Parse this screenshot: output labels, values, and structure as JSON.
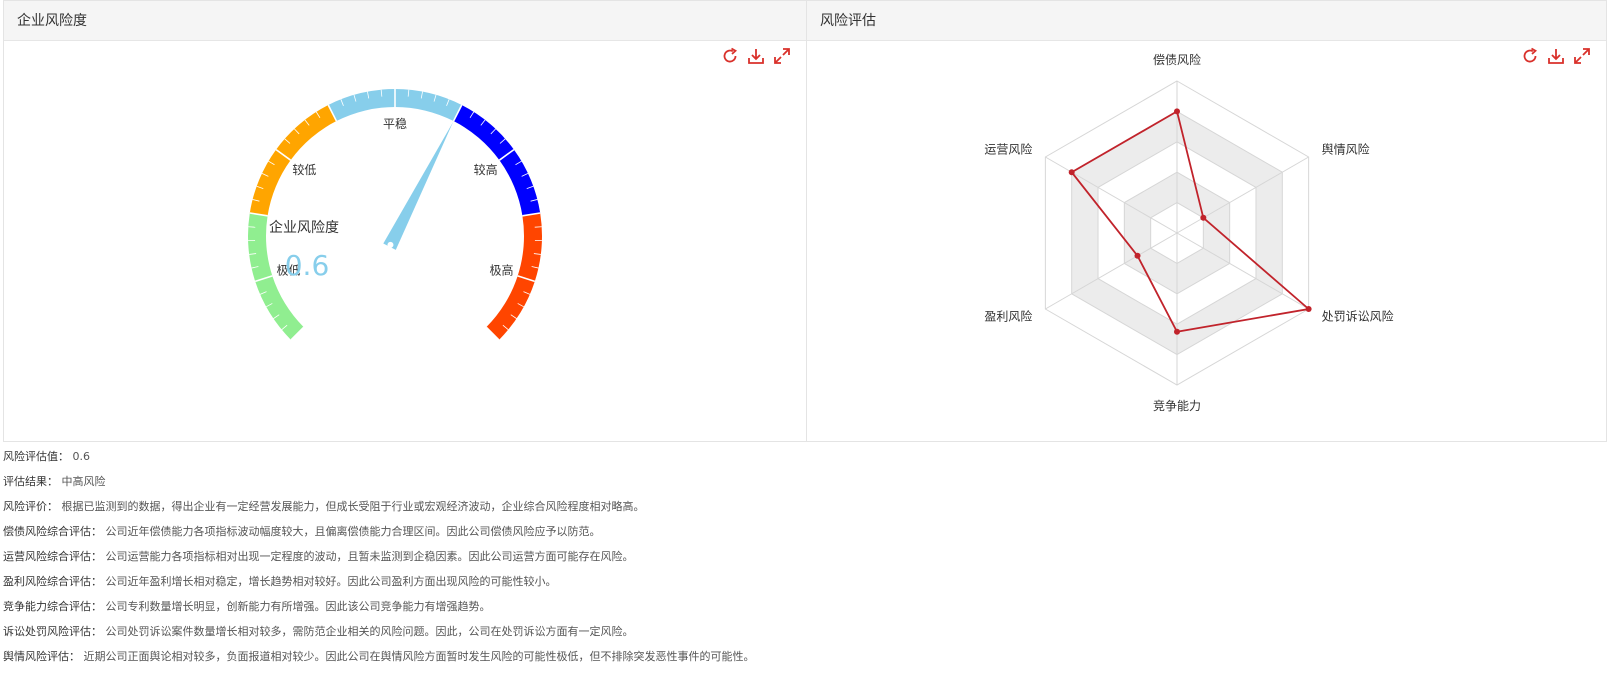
{
  "panels": {
    "left_title": "企业风险度",
    "right_title": "风险评估"
  },
  "colors": {
    "accent": "#d9312b",
    "gauge_value": "#87ceeb",
    "radar_line": "#c1232b"
  },
  "toolbox_icons": [
    "refresh-icon",
    "download-icon",
    "fullscreen-icon"
  ],
  "chart_data": [
    {
      "type": "gauge",
      "title": "企业风险度",
      "value": 0.6,
      "value_label": "0.6",
      "min": 0,
      "max": 1,
      "bands": [
        {
          "label": "极低",
          "to": 0.2,
          "color": "#90ee90"
        },
        {
          "label": "较低",
          "to": 0.4,
          "color": "#ffa500"
        },
        {
          "label": "平稳",
          "to": 0.6,
          "color": "#87ceeb"
        },
        {
          "label": "较高",
          "to": 0.8,
          "color": "#0000ff"
        },
        {
          "label": "极高",
          "to": 1.0,
          "color": "#ff4500"
        }
      ]
    },
    {
      "type": "radar",
      "indicators": [
        "偿债风险",
        "舆情风险",
        "处罚诉讼风险",
        "竞争能力",
        "盈利风险",
        "运营风险"
      ],
      "max": 1,
      "series": [
        {
          "values": [
            0.8,
            0.2,
            1.0,
            0.65,
            0.3,
            0.8
          ]
        }
      ]
    }
  ],
  "info": [
    {
      "label": "风险评估值：",
      "text": " 0.6"
    },
    {
      "label": "评估结果：",
      "text": " 中高风险"
    },
    {
      "label": "风险评价：",
      "text": " 根据已监测到的数据，得出企业有一定经营发展能力，但成长受阻于行业或宏观经济波动，企业综合风险程度相对略高。"
    },
    {
      "label": "偿债风险综合评估：",
      "text": " 公司近年偿债能力各项指标波动幅度较大，且偏离偿债能力合理区间。因此公司偿债风险应予以防范。"
    },
    {
      "label": "运营风险综合评估：",
      "text": " 公司运营能力各项指标相对出现一定程度的波动，且暂未监测到企稳因素。因此公司运营方面可能存在风险。"
    },
    {
      "label": "盈利风险综合评估：",
      "text": " 公司近年盈利增长相对稳定，增长趋势相对较好。因此公司盈利方面出现风险的可能性较小。"
    },
    {
      "label": "竞争能力综合评估：",
      "text": " 公司专利数量增长明显，创新能力有所增强。因此该公司竞争能力有增强趋势。"
    },
    {
      "label": "诉讼处罚风险评估：",
      "text": " 公司处罚诉讼案件数量增长相对较多，需防范企业相关的风险问题。因此，公司在处罚诉讼方面有一定风险。"
    },
    {
      "label": "舆情风险评估：",
      "text": " 近期公司正面舆论相对较多，负面报道相对较少。因此公司在舆情风险方面暂时发生风险的可能性极低，但不排除突发恶性事件的可能性。"
    }
  ]
}
